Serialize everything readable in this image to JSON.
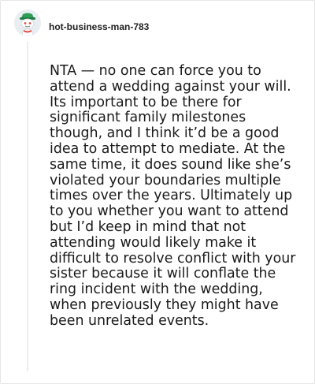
{
  "comment": {
    "author": {
      "username": "hot-business-man-783",
      "avatar_icon": "snoo-avatar-icon"
    },
    "body": "NTA — no one can force you to attend a wedding against your will. Its important to be there for significant family milestones though, and I think it’d be a good idea to attempt to mediate. At the same time, it does sound like she’s violated your boundaries multiple times over the years. Ultimately up to you whether you want to attend but I’d keep in mind that not attending would likely make it difficult to resolve conflict with your sister because it will conflate the ring incident with the wedding, when previously they might have been unrelated events."
  },
  "colors": {
    "text": "#1a1a1b",
    "avatar_green": "#2e9e57",
    "avatar_red": "#e8483a",
    "thread_line": "#ededed"
  }
}
